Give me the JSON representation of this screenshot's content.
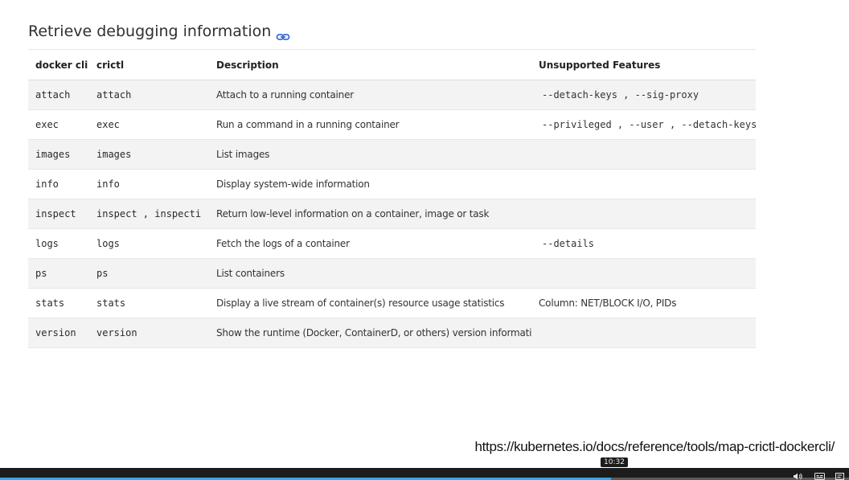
{
  "section": {
    "title": "Retrieve debugging information",
    "link_icon": "link-icon"
  },
  "table": {
    "headers": [
      "docker cli",
      "crictl",
      "Description",
      "Unsupported Features"
    ],
    "rows": [
      {
        "docker": "attach",
        "crictl": "attach",
        "description": "Attach to a running container",
        "unsupported": "--detach-keys , --sig-proxy"
      },
      {
        "docker": "exec",
        "crictl": "exec",
        "description": "Run a command in a running container",
        "unsupported": "--privileged , --user , --detach-keys"
      },
      {
        "docker": "images",
        "crictl": "images",
        "description": "List images",
        "unsupported": ""
      },
      {
        "docker": "info",
        "crictl": "info",
        "description": "Display system-wide information",
        "unsupported": ""
      },
      {
        "docker": "inspect",
        "crictl": "inspect , inspecti",
        "description": "Return low-level information on a container, image or task",
        "unsupported": ""
      },
      {
        "docker": "logs",
        "crictl": "logs",
        "description": "Fetch the logs of a container",
        "unsupported": "--details"
      },
      {
        "docker": "ps",
        "crictl": "ps",
        "description": "List containers",
        "unsupported": ""
      },
      {
        "docker": "stats",
        "crictl": "stats",
        "description": "Display a live stream of container(s) resource usage statistics",
        "unsupported": "Column: NET/BLOCK I/O, PIDs"
      },
      {
        "docker": "version",
        "crictl": "version",
        "description": "Show the runtime (Docker, ContainerD, or others) version information",
        "unsupported": ""
      }
    ]
  },
  "source_url": "https://kubernetes.io/docs/reference/tools/map-crictl-dockercli/",
  "player": {
    "hover_time": "10:32",
    "progress_fraction": 0.72,
    "accent_color": "#35a7e8",
    "icons": [
      "volume-icon",
      "captions-icon",
      "settings-icon"
    ]
  }
}
